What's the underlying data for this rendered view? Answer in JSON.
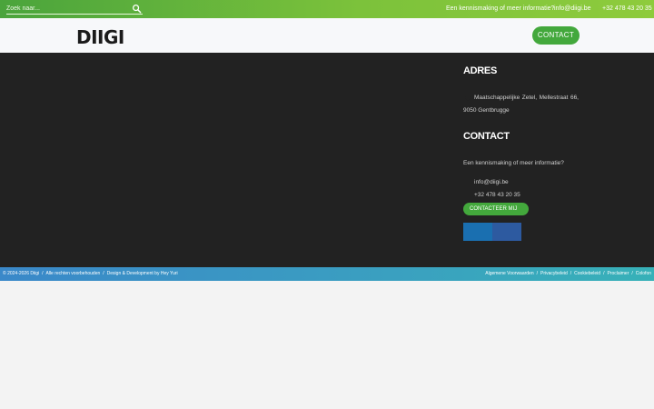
{
  "topbar": {
    "search_placeholder": "Zoek naar...",
    "tagline": "Een kennismaking of meer informatie?",
    "email": "info@diigi.be",
    "phone": "+32 478 43 20 35"
  },
  "header": {
    "logo": "DIIGI",
    "contact_button": "CONTACT"
  },
  "footer": {
    "address_title": "ADRES",
    "address_line1": "Maatschappelijke Zetel, Mellestraat 66,",
    "address_line2": "9050 Gentbrugge",
    "contact_title": "CONTACT",
    "contact_tagline": "Een kennismaking of meer informatie?",
    "email": "info@diigi.be",
    "phone": "+32 478 43 20 35",
    "contact_button": "CONTACTEER MIJ"
  },
  "bottombar": {
    "copyright": "© 2024-2026 Diigi",
    "rights": "Alle rechten voorbehouden",
    "credits": "Design & Development by Hey Yuri",
    "links": [
      "Algemene Voorwaarden",
      "Privacybeleid",
      "Cookiebeleid",
      "Proclaimer",
      "Colofon"
    ],
    "separator": "/"
  },
  "colors": {
    "green": "#43a83c",
    "dark_bg": "#222222",
    "blue_bar": "#3a88c9"
  }
}
